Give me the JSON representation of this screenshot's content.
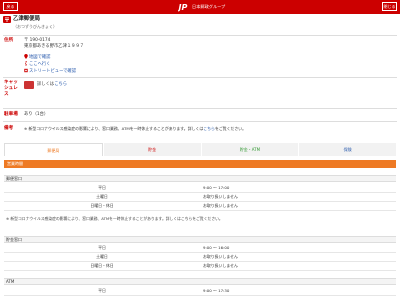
{
  "topbar": {
    "back_label": "戻る",
    "brand_name": "日本郵政グループ",
    "close_label": "閉じる"
  },
  "office": {
    "name": "乙津郵便局",
    "kana": "（おつずうびんきょく）"
  },
  "address": {
    "label": "住所",
    "postal": "〒 190-0174",
    "street": "東京都あきる野市乙津１９９７",
    "links": [
      "地図で確認",
      "ここへ行く",
      "ストリートビューで確認"
    ]
  },
  "cashless": {
    "label": "キャッシュレス",
    "text_prefix": "詳しくは",
    "link": "こちら"
  },
  "parking": {
    "label": "駐車場",
    "value": "あり（1台）"
  },
  "remarks": {
    "label": "備考",
    "text_prefix": "※ 新型コロナウイルス感染症の影響により、窓口業務、ATMを一時休止することがあります。詳しくは",
    "link": "こちら",
    "text_suffix": "をご覧ください。"
  },
  "tabs": [
    "郵便局",
    "貯金",
    "貯金・ATM",
    "保険"
  ],
  "hours_heading": "営業時間",
  "sections": [
    {
      "title": "郵便窓口",
      "rows": [
        {
          "day": "平日",
          "time": "9:00 ～ 17:00"
        },
        {
          "day": "土曜日",
          "time": "お取り扱いしません"
        },
        {
          "day": "日曜日・休日",
          "time": "お取り扱いしません"
        }
      ],
      "note": "※ 新型コロナウイルス感染症の影響により、窓口業務、ATMを一時休止することがあります。詳しくはこちらをご覧ください。"
    },
    {
      "title": "貯金窓口",
      "rows": [
        {
          "day": "平日",
          "time": "9:00 ～ 16:00"
        },
        {
          "day": "土曜日",
          "time": "お取り扱いしません"
        },
        {
          "day": "日曜日・休日",
          "time": "お取り扱いしません"
        }
      ],
      "note": ""
    },
    {
      "title": "ATM",
      "rows": [
        {
          "day": "平日",
          "time": "9:00 ～ 17:30"
        }
      ],
      "note": ""
    }
  ],
  "colors": {
    "brand_red": "#cc0000",
    "accent_orange": "#ee7a24",
    "link_blue": "#2255aa"
  }
}
